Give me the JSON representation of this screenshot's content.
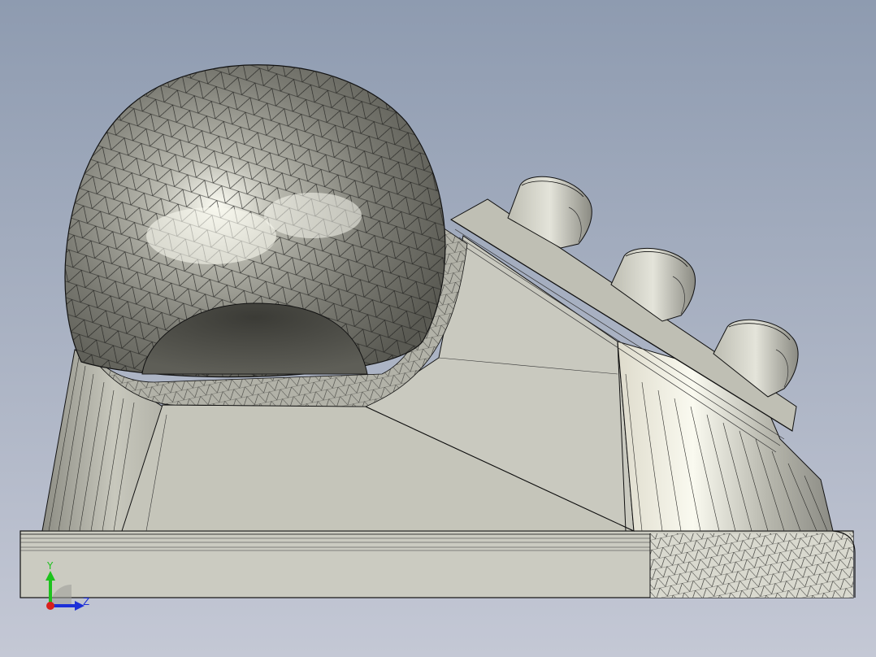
{
  "viewport": {
    "background_top": "#8e9bb0",
    "background_bottom": "#c4c8d5"
  },
  "part": {
    "face_color": "#c7c7bd",
    "shadow_color": "#4c4c46",
    "highlight_color": "#f6f6ee",
    "edge_color": "#1a1a1a"
  },
  "triad": {
    "y_label": "Y",
    "z_label": "Z",
    "y_color": "#1ec21e",
    "z_color": "#1c2fd8",
    "x_color": "#d8201c"
  }
}
